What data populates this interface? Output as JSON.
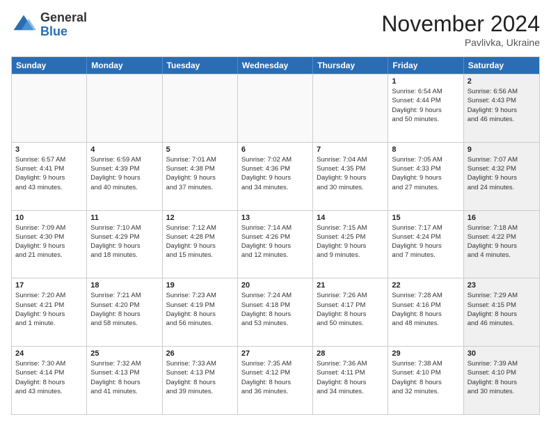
{
  "header": {
    "logo_general": "General",
    "logo_blue": "Blue",
    "month_title": "November 2024",
    "location": "Pavlivka, Ukraine"
  },
  "calendar": {
    "days_of_week": [
      "Sunday",
      "Monday",
      "Tuesday",
      "Wednesday",
      "Thursday",
      "Friday",
      "Saturday"
    ],
    "weeks": [
      [
        {
          "day": "",
          "info": ""
        },
        {
          "day": "",
          "info": ""
        },
        {
          "day": "",
          "info": ""
        },
        {
          "day": "",
          "info": ""
        },
        {
          "day": "",
          "info": ""
        },
        {
          "day": "1",
          "info": "Sunrise: 6:54 AM\nSunset: 4:44 PM\nDaylight: 9 hours\nand 50 minutes."
        },
        {
          "day": "2",
          "info": "Sunrise: 6:56 AM\nSunset: 4:43 PM\nDaylight: 9 hours\nand 46 minutes."
        }
      ],
      [
        {
          "day": "3",
          "info": "Sunrise: 6:57 AM\nSunset: 4:41 PM\nDaylight: 9 hours\nand 43 minutes."
        },
        {
          "day": "4",
          "info": "Sunrise: 6:59 AM\nSunset: 4:39 PM\nDaylight: 9 hours\nand 40 minutes."
        },
        {
          "day": "5",
          "info": "Sunrise: 7:01 AM\nSunset: 4:38 PM\nDaylight: 9 hours\nand 37 minutes."
        },
        {
          "day": "6",
          "info": "Sunrise: 7:02 AM\nSunset: 4:36 PM\nDaylight: 9 hours\nand 34 minutes."
        },
        {
          "day": "7",
          "info": "Sunrise: 7:04 AM\nSunset: 4:35 PM\nDaylight: 9 hours\nand 30 minutes."
        },
        {
          "day": "8",
          "info": "Sunrise: 7:05 AM\nSunset: 4:33 PM\nDaylight: 9 hours\nand 27 minutes."
        },
        {
          "day": "9",
          "info": "Sunrise: 7:07 AM\nSunset: 4:32 PM\nDaylight: 9 hours\nand 24 minutes."
        }
      ],
      [
        {
          "day": "10",
          "info": "Sunrise: 7:09 AM\nSunset: 4:30 PM\nDaylight: 9 hours\nand 21 minutes."
        },
        {
          "day": "11",
          "info": "Sunrise: 7:10 AM\nSunset: 4:29 PM\nDaylight: 9 hours\nand 18 minutes."
        },
        {
          "day": "12",
          "info": "Sunrise: 7:12 AM\nSunset: 4:28 PM\nDaylight: 9 hours\nand 15 minutes."
        },
        {
          "day": "13",
          "info": "Sunrise: 7:14 AM\nSunset: 4:26 PM\nDaylight: 9 hours\nand 12 minutes."
        },
        {
          "day": "14",
          "info": "Sunrise: 7:15 AM\nSunset: 4:25 PM\nDaylight: 9 hours\nand 9 minutes."
        },
        {
          "day": "15",
          "info": "Sunrise: 7:17 AM\nSunset: 4:24 PM\nDaylight: 9 hours\nand 7 minutes."
        },
        {
          "day": "16",
          "info": "Sunrise: 7:18 AM\nSunset: 4:22 PM\nDaylight: 9 hours\nand 4 minutes."
        }
      ],
      [
        {
          "day": "17",
          "info": "Sunrise: 7:20 AM\nSunset: 4:21 PM\nDaylight: 9 hours\nand 1 minute."
        },
        {
          "day": "18",
          "info": "Sunrise: 7:21 AM\nSunset: 4:20 PM\nDaylight: 8 hours\nand 58 minutes."
        },
        {
          "day": "19",
          "info": "Sunrise: 7:23 AM\nSunset: 4:19 PM\nDaylight: 8 hours\nand 56 minutes."
        },
        {
          "day": "20",
          "info": "Sunrise: 7:24 AM\nSunset: 4:18 PM\nDaylight: 8 hours\nand 53 minutes."
        },
        {
          "day": "21",
          "info": "Sunrise: 7:26 AM\nSunset: 4:17 PM\nDaylight: 8 hours\nand 50 minutes."
        },
        {
          "day": "22",
          "info": "Sunrise: 7:28 AM\nSunset: 4:16 PM\nDaylight: 8 hours\nand 48 minutes."
        },
        {
          "day": "23",
          "info": "Sunrise: 7:29 AM\nSunset: 4:15 PM\nDaylight: 8 hours\nand 46 minutes."
        }
      ],
      [
        {
          "day": "24",
          "info": "Sunrise: 7:30 AM\nSunset: 4:14 PM\nDaylight: 8 hours\nand 43 minutes."
        },
        {
          "day": "25",
          "info": "Sunrise: 7:32 AM\nSunset: 4:13 PM\nDaylight: 8 hours\nand 41 minutes."
        },
        {
          "day": "26",
          "info": "Sunrise: 7:33 AM\nSunset: 4:13 PM\nDaylight: 8 hours\nand 39 minutes."
        },
        {
          "day": "27",
          "info": "Sunrise: 7:35 AM\nSunset: 4:12 PM\nDaylight: 8 hours\nand 36 minutes."
        },
        {
          "day": "28",
          "info": "Sunrise: 7:36 AM\nSunset: 4:11 PM\nDaylight: 8 hours\nand 34 minutes."
        },
        {
          "day": "29",
          "info": "Sunrise: 7:38 AM\nSunset: 4:10 PM\nDaylight: 8 hours\nand 32 minutes."
        },
        {
          "day": "30",
          "info": "Sunrise: 7:39 AM\nSunset: 4:10 PM\nDaylight: 8 hours\nand 30 minutes."
        }
      ]
    ]
  }
}
